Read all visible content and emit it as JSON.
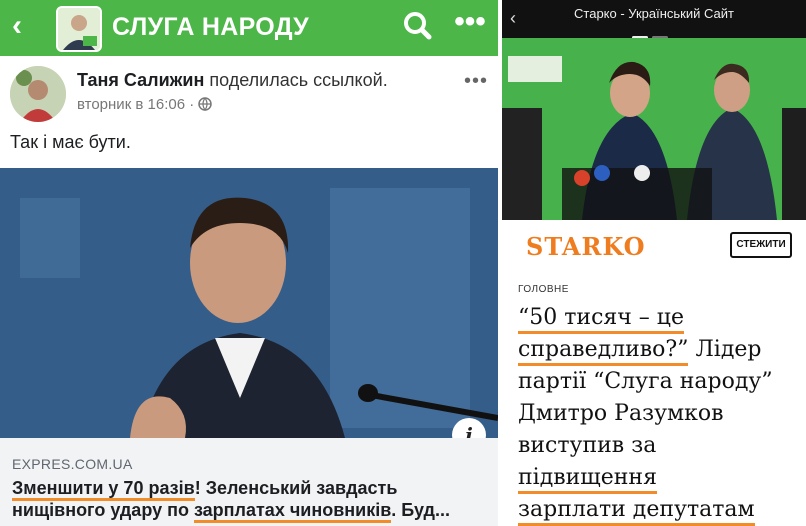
{
  "facebook": {
    "header": {
      "page_title": "СЛУГА НАРОДУ"
    },
    "post": {
      "author": "Таня Салижин",
      "action": " поделилась ссылкой.",
      "time": "вторник в 16:06 · ",
      "text": "Так і має бути."
    },
    "link": {
      "domain": "EXPRES.COM.UA",
      "title_part1_underlined": "Зменшити у 70 разів",
      "title_part1_rest": "! Зеленський завдасть",
      "title_part2_a": "нищівного удару по ",
      "title_part2_underlined": "зарплатах чиновників",
      "title_part2_rest": ". Буд..."
    }
  },
  "starko": {
    "tab_title": "Старко - Український Сайт",
    "logo": "STARKO",
    "follow_label": "СТЕЖИТИ",
    "section": "ГОЛОВНЕ",
    "headline": {
      "line1_underlined": "“50 тисяч – це",
      "line2_underlined": "справедливо?”",
      "line2_rest": " Лідер",
      "line3": "партії “Слуга народу”",
      "line4": "Дмитро Разумков",
      "line5": "виступив за",
      "line6_underlined": "підвищення",
      "line7_underlined": "зарплати депутатам"
    }
  },
  "colors": {
    "fb_green": "#4cb648",
    "accent_orange": "#f28c28",
    "starko_orange": "#ef7d1f"
  }
}
